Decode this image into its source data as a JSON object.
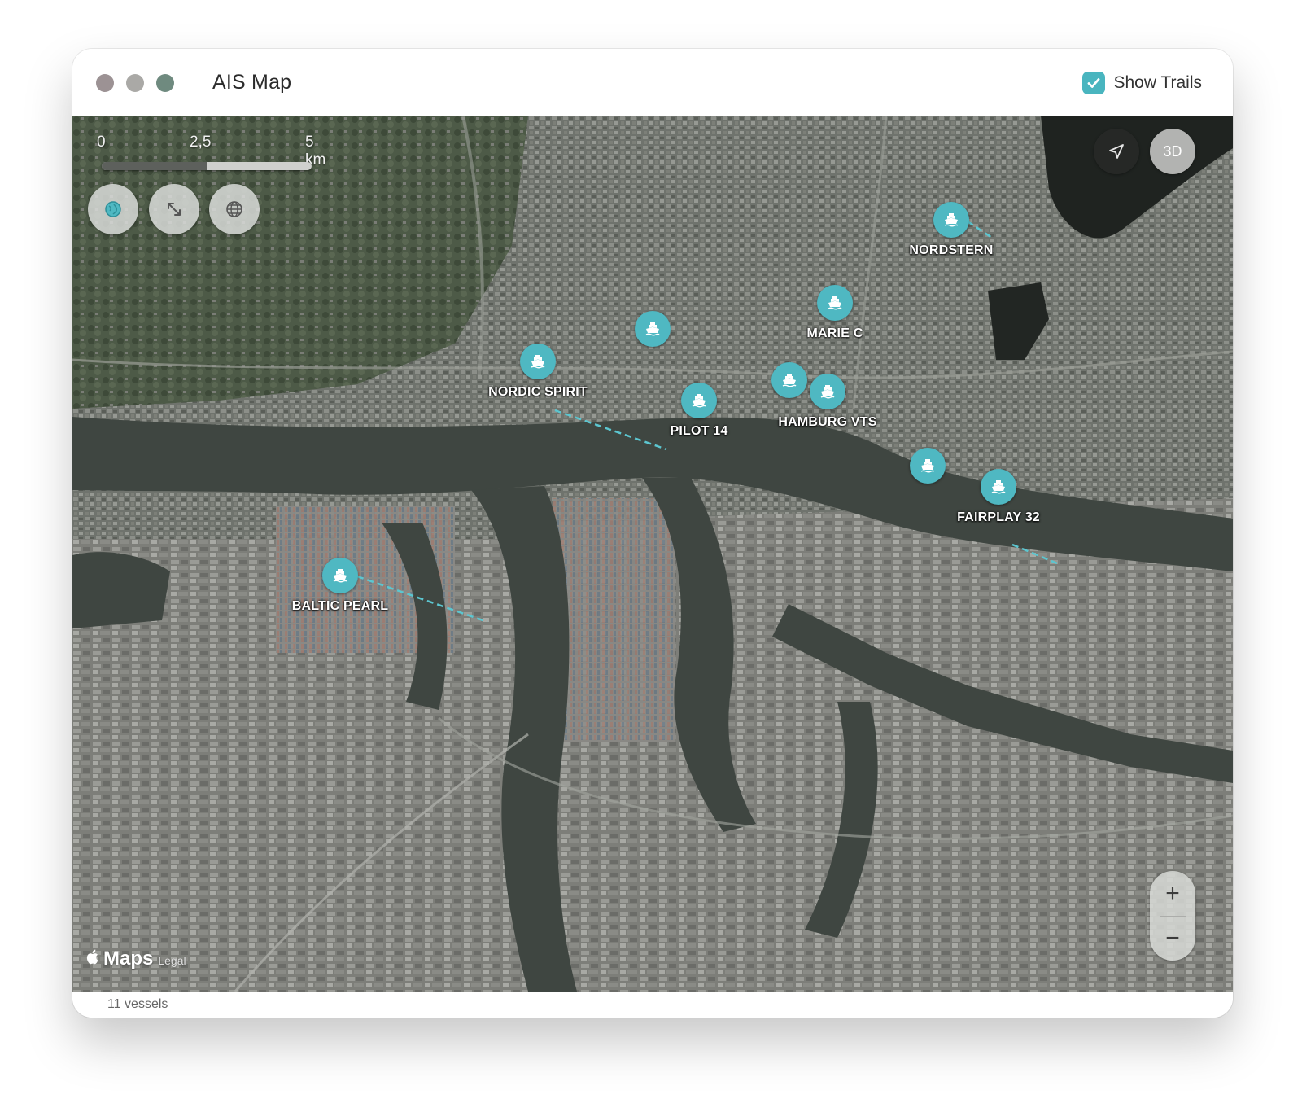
{
  "window": {
    "title": "AIS Map",
    "show_trails_label": "Show Trails",
    "show_trails_checked": true
  },
  "map": {
    "scale": {
      "labels": [
        "0",
        "2,5",
        "5 km"
      ]
    },
    "controls": {
      "three_d_label": "3D",
      "zoom_in_label": "+",
      "zoom_out_label": "−"
    },
    "attribution": {
      "brand": "Maps",
      "legal": "Legal"
    },
    "colors": {
      "vessel": "#4fb8c2",
      "trail": "#5cc6d0"
    },
    "vessels": [
      {
        "label": "NORDSTERN"
      },
      {
        "label": "MARIE C"
      },
      {
        "label": ""
      },
      {
        "label": "NORDIC SPIRIT"
      },
      {
        "label": "PILOT 14"
      },
      {
        "label": ""
      },
      {
        "label": "HAMBURG VTS"
      },
      {
        "label": ""
      },
      {
        "label": "FAIRPLAY 32"
      },
      {
        "label": "BALTIC PEARL"
      }
    ]
  },
  "status": {
    "vessel_count": "11 vessels"
  }
}
